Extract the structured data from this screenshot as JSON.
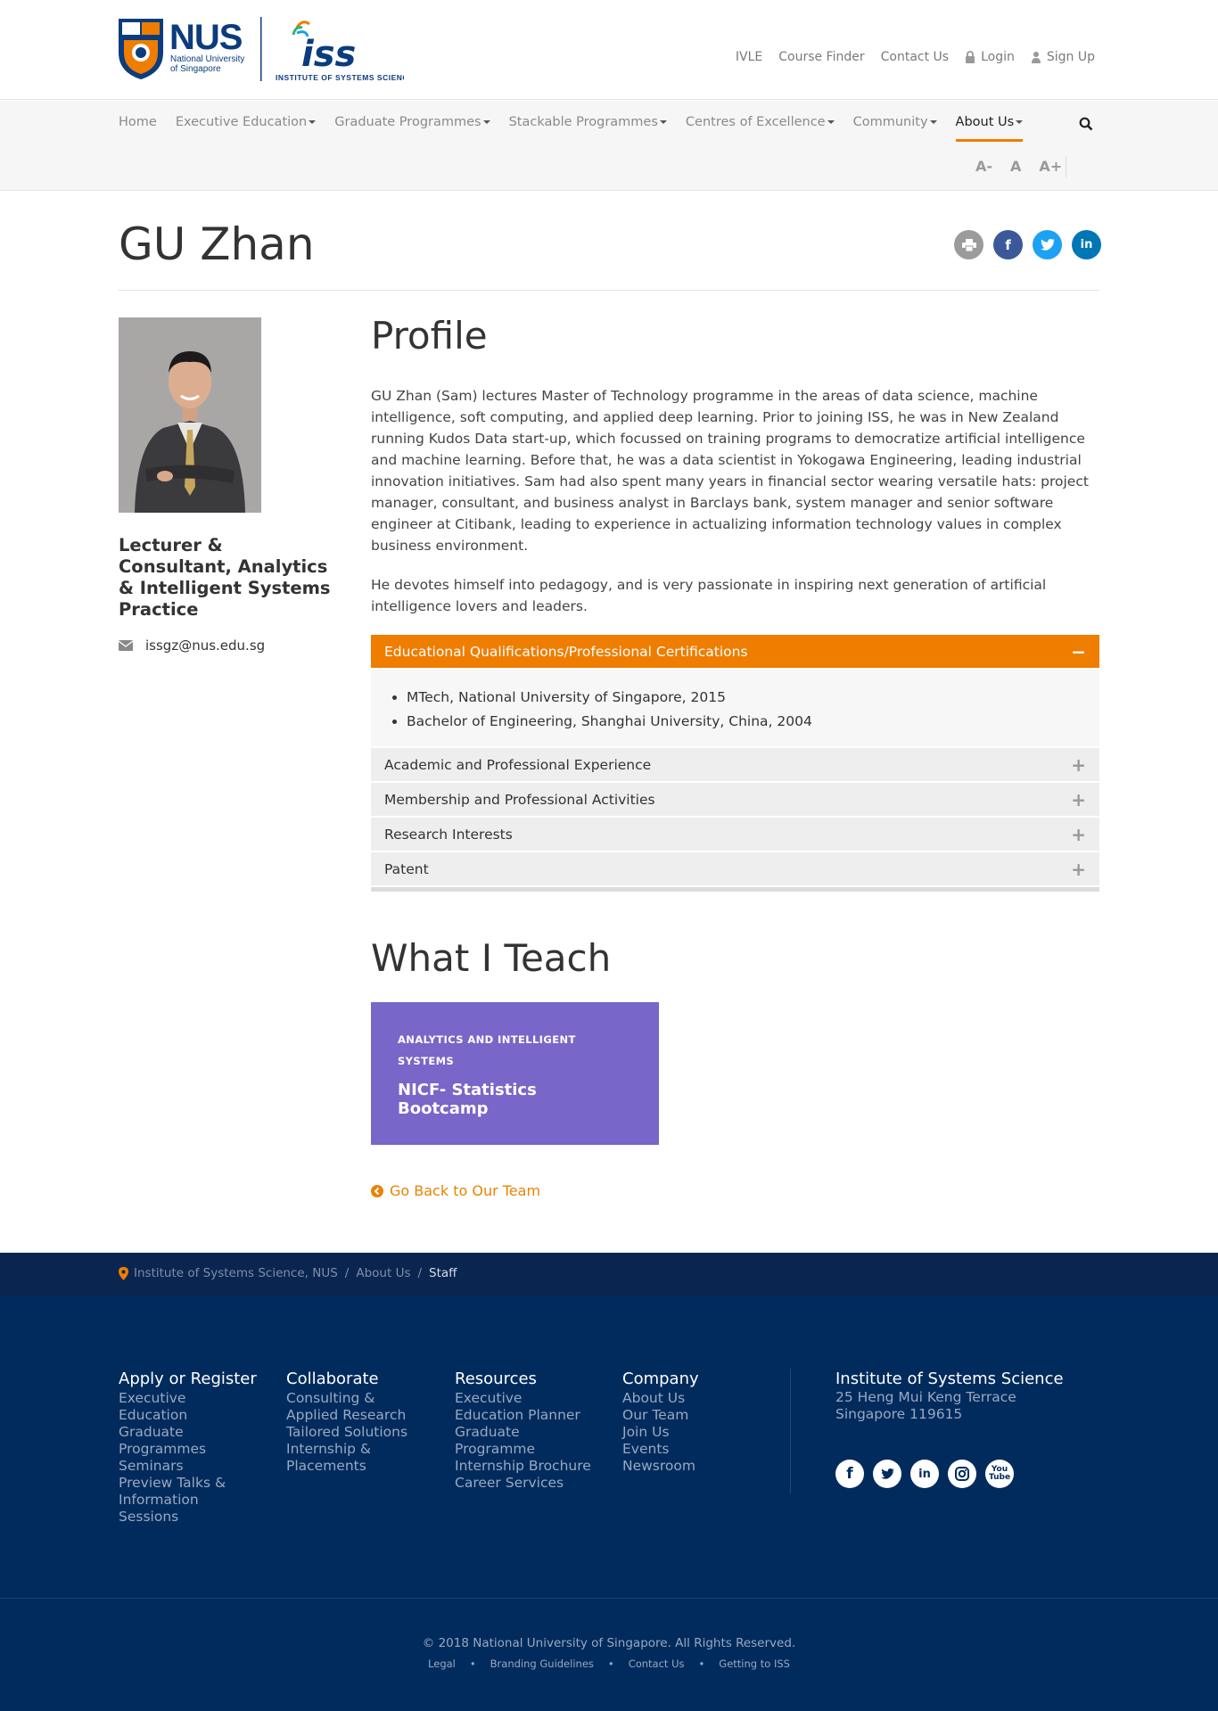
{
  "header": {
    "logo_nus_text": "NUS",
    "logo_nus_sub": "National University of Singapore",
    "logo_iss_text": "iss",
    "logo_iss_sub": "INSTITUTE OF SYSTEMS SCIENCE",
    "top_links": [
      "IVLE",
      "Course Finder",
      "Contact Us",
      "Login",
      "Sign Up"
    ]
  },
  "nav": {
    "items": [
      "Home",
      "Executive Education",
      "Graduate Programmes",
      "Stackable Programmes",
      "Centres of Excellence",
      "Community",
      "About Us"
    ],
    "active": "About Us",
    "font_sizes": [
      "A-",
      "A",
      "A+"
    ]
  },
  "page": {
    "title": "GU Zhan"
  },
  "person": {
    "role": "Lecturer & Consultant, Analytics & Intelligent Systems Practice",
    "email": "issgz@nus.edu.sg"
  },
  "profile": {
    "heading": "Profile",
    "bio_1": "GU Zhan (Sam) lectures Master of Technology programme in the areas of data science, machine intelligence, soft computing, and applied deep learning. Prior to joining ISS, he was in New Zealand running Kudos Data start-up, which focussed on training programs to democratize artificial intelligence and machine learning.  Before that, he was a data scientist in Yokogawa Engineering, leading industrial innovation initiatives.  Sam had also spent many years in financial sector wearing versatile hats: project manager, consultant, and business analyst in Barclays bank, system manager and senior software engineer at Citibank, leading to experience in actualizing information technology values in complex business environment.",
    "bio_2": "He devotes himself into pedagogy, and is very passionate in inspiring next generation of artificial intelligence lovers and leaders."
  },
  "accordion": {
    "open": {
      "title": "Educational Qualifications/Professional Certifications",
      "items": [
        "MTech, National University of Singapore, 2015",
        "Bachelor of Engineering, Shanghai University, China, 2004"
      ]
    },
    "closed": [
      "Academic and Professional Experience",
      "Membership and Professional Activities",
      "Research Interests",
      "Patent"
    ]
  },
  "teach": {
    "heading": "What I Teach",
    "course_category": "ANALYTICS AND INTELLIGENT SYSTEMS",
    "course_name": "NICF- Statistics Bootcamp",
    "go_back": "Go Back to Our Team"
  },
  "breadcrumb": [
    "Institute of Systems Science, NUS",
    "About Us",
    "Staff"
  ],
  "footer": {
    "columns": [
      {
        "title": "Apply or Register",
        "links": [
          "Executive",
          "Education",
          "Graduate",
          "Programmes",
          "Seminars",
          "Preview Talks &",
          "Information",
          "Sessions"
        ]
      },
      {
        "title": "Collaborate",
        "links": [
          "Consulting &",
          "Applied Research",
          "Tailored Solutions",
          "Internship &",
          "Placements"
        ]
      },
      {
        "title": "Resources",
        "links": [
          "Executive",
          "Education Planner",
          "Graduate",
          "Programme",
          "Internship Brochure",
          "Career Services"
        ]
      },
      {
        "title": "Company",
        "links": [
          "About Us",
          "Our Team",
          "Join Us",
          "Events",
          "Newsroom"
        ]
      }
    ],
    "address_title": "Institute of Systems Science",
    "address_line1": "25 Heng Mui Keng Terrace",
    "address_line2": "Singapore 119615",
    "social": [
      "facebook-icon",
      "twitter-icon",
      "linkedin-icon",
      "instagram-icon",
      "youtube-icon"
    ],
    "copyright": "© 2018 National University of Singapore. All Rights Reserved.",
    "legal_links": [
      "Legal",
      "Branding Guidelines",
      "Contact Us",
      "Getting to ISS"
    ]
  },
  "colors": {
    "accent": "#ef7d00",
    "course_card": "#7866c8",
    "footer_bg": "#012b5d",
    "crumb_bg": "#0a2550"
  }
}
